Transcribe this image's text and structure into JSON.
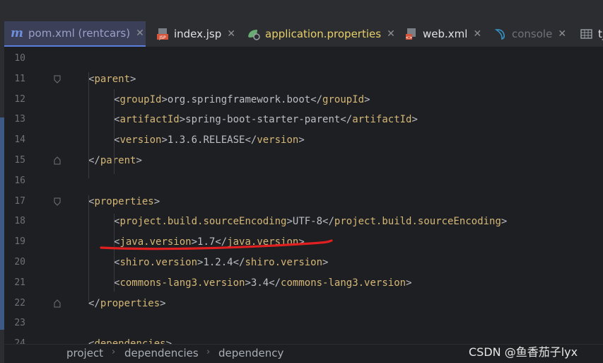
{
  "tabs": [
    {
      "label": "pom.xml (rentcars)",
      "icon": "maven-icon",
      "active": true
    },
    {
      "label": "index.jsp",
      "icon": "jsp-file-icon"
    },
    {
      "label": "application.properties",
      "icon": "spring-properties-icon"
    },
    {
      "label": "web.xml",
      "icon": "web-xml-icon"
    },
    {
      "label": "console",
      "icon": "sql-console-icon"
    },
    {
      "label": "t_",
      "icon": "table-icon"
    }
  ],
  "editor": {
    "lines": [
      {
        "num": "10",
        "indent": 0,
        "parts": []
      },
      {
        "num": "11",
        "indent": 1,
        "parts": [
          [
            "br",
            "<"
          ],
          [
            "tg",
            "parent"
          ],
          [
            "br",
            ">"
          ]
        ]
      },
      {
        "num": "12",
        "indent": 2,
        "parts": [
          [
            "br",
            "<"
          ],
          [
            "tg",
            "groupId"
          ],
          [
            "br",
            ">"
          ],
          [
            "tx",
            "org.springframework.boot"
          ],
          [
            "br",
            "</"
          ],
          [
            "tg",
            "groupId"
          ],
          [
            "br",
            ">"
          ]
        ]
      },
      {
        "num": "13",
        "indent": 2,
        "parts": [
          [
            "br",
            "<"
          ],
          [
            "tg",
            "artifactId"
          ],
          [
            "br",
            ">"
          ],
          [
            "tx",
            "spring-boot-starter-parent"
          ],
          [
            "br",
            "</"
          ],
          [
            "tg",
            "artifactId"
          ],
          [
            "br",
            ">"
          ]
        ]
      },
      {
        "num": "14",
        "indent": 2,
        "parts": [
          [
            "br",
            "<"
          ],
          [
            "tg",
            "version"
          ],
          [
            "br",
            ">"
          ],
          [
            "tx",
            "1.3.6.RELEASE"
          ],
          [
            "br",
            "</"
          ],
          [
            "tg",
            "version"
          ],
          [
            "br",
            ">"
          ]
        ]
      },
      {
        "num": "15",
        "indent": 1,
        "parts": [
          [
            "br",
            "</"
          ],
          [
            "tg",
            "parent"
          ],
          [
            "br",
            ">"
          ]
        ]
      },
      {
        "num": "16",
        "indent": 0,
        "parts": []
      },
      {
        "num": "17",
        "indent": 1,
        "parts": [
          [
            "br",
            "<"
          ],
          [
            "tg",
            "properties"
          ],
          [
            "br",
            ">"
          ]
        ]
      },
      {
        "num": "18",
        "indent": 2,
        "parts": [
          [
            "br",
            "<"
          ],
          [
            "tg",
            "project.build.sourceEncoding"
          ],
          [
            "br",
            ">"
          ],
          [
            "tx",
            "UTF-8"
          ],
          [
            "br",
            "</"
          ],
          [
            "tg",
            "project.build.sourceEncoding"
          ],
          [
            "br",
            ">"
          ]
        ]
      },
      {
        "num": "19",
        "indent": 2,
        "parts": [
          [
            "br",
            "<"
          ],
          [
            "tg",
            "java.version"
          ],
          [
            "br",
            ">"
          ],
          [
            "tx",
            "1.7"
          ],
          [
            "br",
            "</"
          ],
          [
            "tg",
            "java.version"
          ],
          [
            "br",
            ">"
          ]
        ]
      },
      {
        "num": "20",
        "indent": 2,
        "parts": [
          [
            "br",
            "<"
          ],
          [
            "tg",
            "shiro.version"
          ],
          [
            "br",
            ">"
          ],
          [
            "tx",
            "1.2.4"
          ],
          [
            "br",
            "</"
          ],
          [
            "tg",
            "shiro.version"
          ],
          [
            "br",
            ">"
          ]
        ]
      },
      {
        "num": "21",
        "indent": 2,
        "parts": [
          [
            "br",
            "<"
          ],
          [
            "tg",
            "commons-lang3.version"
          ],
          [
            "br",
            ">"
          ],
          [
            "tx",
            "3.4"
          ],
          [
            "br",
            "</"
          ],
          [
            "tg",
            "commons-lang3.version"
          ],
          [
            "br",
            ">"
          ]
        ]
      },
      {
        "num": "22",
        "indent": 1,
        "parts": [
          [
            "br",
            "</"
          ],
          [
            "tg",
            "properties"
          ],
          [
            "br",
            ">"
          ]
        ]
      },
      {
        "num": "23",
        "indent": 0,
        "parts": []
      },
      {
        "num": "24",
        "indent": 1,
        "parts": [
          [
            "br",
            "<"
          ],
          [
            "tg",
            "dependencies"
          ],
          [
            "br",
            ">"
          ]
        ]
      }
    ]
  },
  "breadcrumb": [
    "project",
    "dependencies",
    "dependency"
  ],
  "watermark": "CSDN @鱼香茄子lyx",
  "colors": {
    "tag": "#d5b778",
    "annotation": "#e02020",
    "accent": "#5b7fdc"
  }
}
